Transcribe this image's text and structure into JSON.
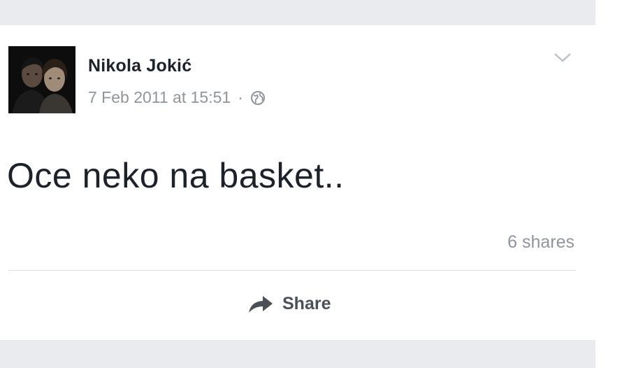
{
  "post": {
    "author": "Nikola Jokić",
    "timestamp": "7 Feb 2011 at 15:51",
    "separator": "·",
    "privacy_icon": "globe-icon",
    "text": "Oce neko na basket..",
    "shares": "6 shares",
    "menu_icon": "chevron-down-icon"
  },
  "actions": {
    "share_label": "Share",
    "share_icon": "share-arrow-icon"
  },
  "colors": {
    "band": "#e9ebee",
    "text": "#1d2129",
    "meta": "#90949c",
    "action": "#4b4f56"
  }
}
